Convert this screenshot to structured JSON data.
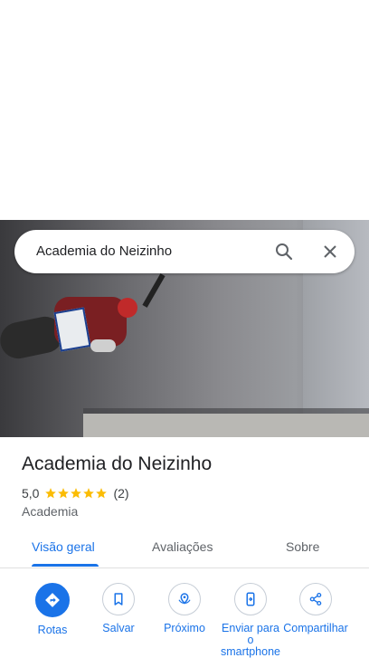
{
  "search": {
    "value": "Academia do Neizinho"
  },
  "place": {
    "name": "Academia do Neizinho",
    "rating": "5,0",
    "review_count": "(2)",
    "stars": 5,
    "category": "Academia"
  },
  "tabs": [
    {
      "label": "Visão geral",
      "active": true
    },
    {
      "label": "Avaliações",
      "active": false
    },
    {
      "label": "Sobre",
      "active": false
    }
  ],
  "actions": [
    {
      "label": "Rotas",
      "icon": "directions-icon"
    },
    {
      "label": "Salvar",
      "icon": "bookmark-icon"
    },
    {
      "label": "Próximo",
      "icon": "nearby-icon"
    },
    {
      "label": "Enviar para o smartphone",
      "icon": "send-to-phone-icon"
    },
    {
      "label": "Compartilhar",
      "icon": "share-icon"
    }
  ],
  "colors": {
    "accent": "#1a73e8",
    "star": "#fbbc04"
  }
}
